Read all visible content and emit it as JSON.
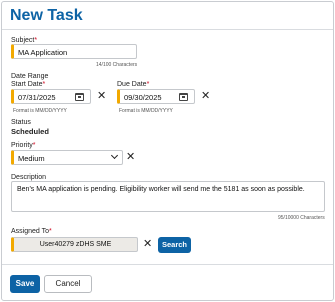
{
  "dialog": {
    "title": "New Task"
  },
  "subject": {
    "label": "Subject",
    "required_mark": "*",
    "value": "MA Application",
    "counter": "14/100 Characters"
  },
  "date_range": {
    "label": "Date Range",
    "start": {
      "label": "Start Date",
      "required_mark": "*",
      "value": "07/31/2025",
      "format_hint": "Format is MM/DD/YYYY"
    },
    "due": {
      "label": "Due Date",
      "required_mark": "*",
      "value": "09/30/2025",
      "format_hint": "Format is MM/DD/YYYY"
    }
  },
  "status": {
    "label": "Status",
    "value": "Scheduled"
  },
  "priority": {
    "label": "Priority",
    "required_mark": "*",
    "value": "Medium"
  },
  "description": {
    "label": "Description",
    "value": "Ben's MA application is pending.  Eligibility worker will send me the 5181 as soon as possible.",
    "counter": "95/10000 Characters"
  },
  "assigned_to": {
    "label": "Assigned To",
    "required_mark": "*",
    "value": "User40279 zDHS SME",
    "search_label": "Search"
  },
  "footer": {
    "save_label": "Save",
    "cancel_label": "Cancel"
  },
  "icons": {
    "clear": "close-icon",
    "calendar": "calendar-icon",
    "dropdown": "chevron-down-icon"
  },
  "colors": {
    "accent": "#0d63a5",
    "required_bar": "#f2a900",
    "required_mark": "#d0021b"
  }
}
